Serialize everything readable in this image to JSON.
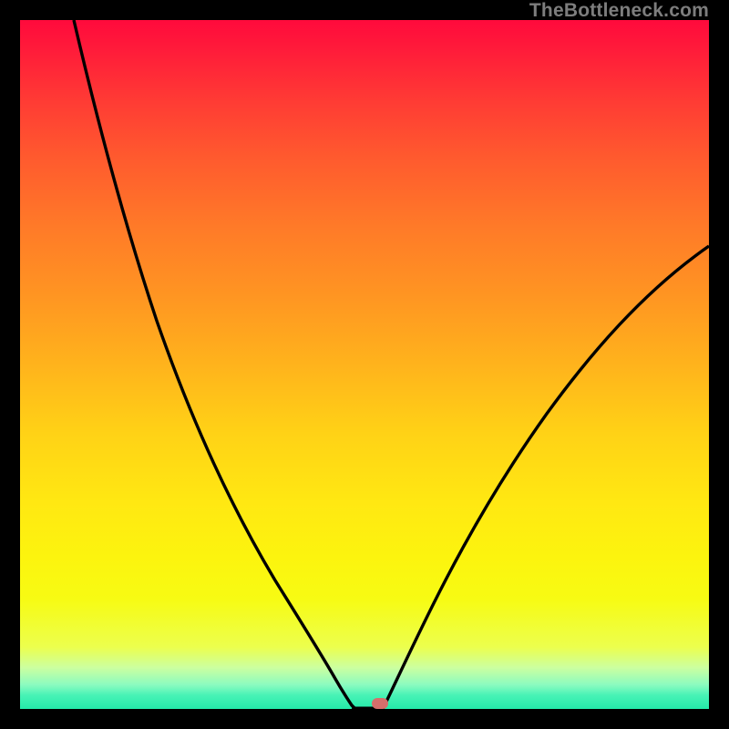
{
  "watermark": "TheBottleneck.com",
  "colors": {
    "background": "#000000",
    "curve": "#000000",
    "marker": "#d66e6b"
  },
  "chart_data": {
    "type": "line",
    "title": "",
    "xlabel": "",
    "ylabel": "",
    "xlim": [
      0,
      100
    ],
    "ylim": [
      0,
      100
    ],
    "grid": false,
    "series": [
      {
        "name": "curve",
        "x": [
          0,
          5,
          10,
          15,
          20,
          25,
          30,
          35,
          40,
          42,
          44,
          46,
          48,
          50,
          52,
          54,
          56,
          58,
          60,
          65,
          70,
          75,
          80,
          85,
          90,
          95,
          100
        ],
        "y": [
          100,
          91,
          82,
          73,
          64,
          55,
          45,
          35,
          23,
          17,
          10,
          4,
          0.5,
          0,
          3,
          8,
          14,
          19,
          23,
          32,
          40,
          46,
          51,
          56,
          60,
          64,
          67
        ]
      }
    ],
    "annotations": [
      {
        "name": "bottleneck-point",
        "x": 50,
        "y": 0
      }
    ],
    "gradient_stops": [
      {
        "pos": 0,
        "color": "#ff0a3c"
      },
      {
        "pos": 50,
        "color": "#ffb31c"
      },
      {
        "pos": 85,
        "color": "#f7fb13"
      },
      {
        "pos": 100,
        "color": "#24e9a9"
      }
    ]
  }
}
